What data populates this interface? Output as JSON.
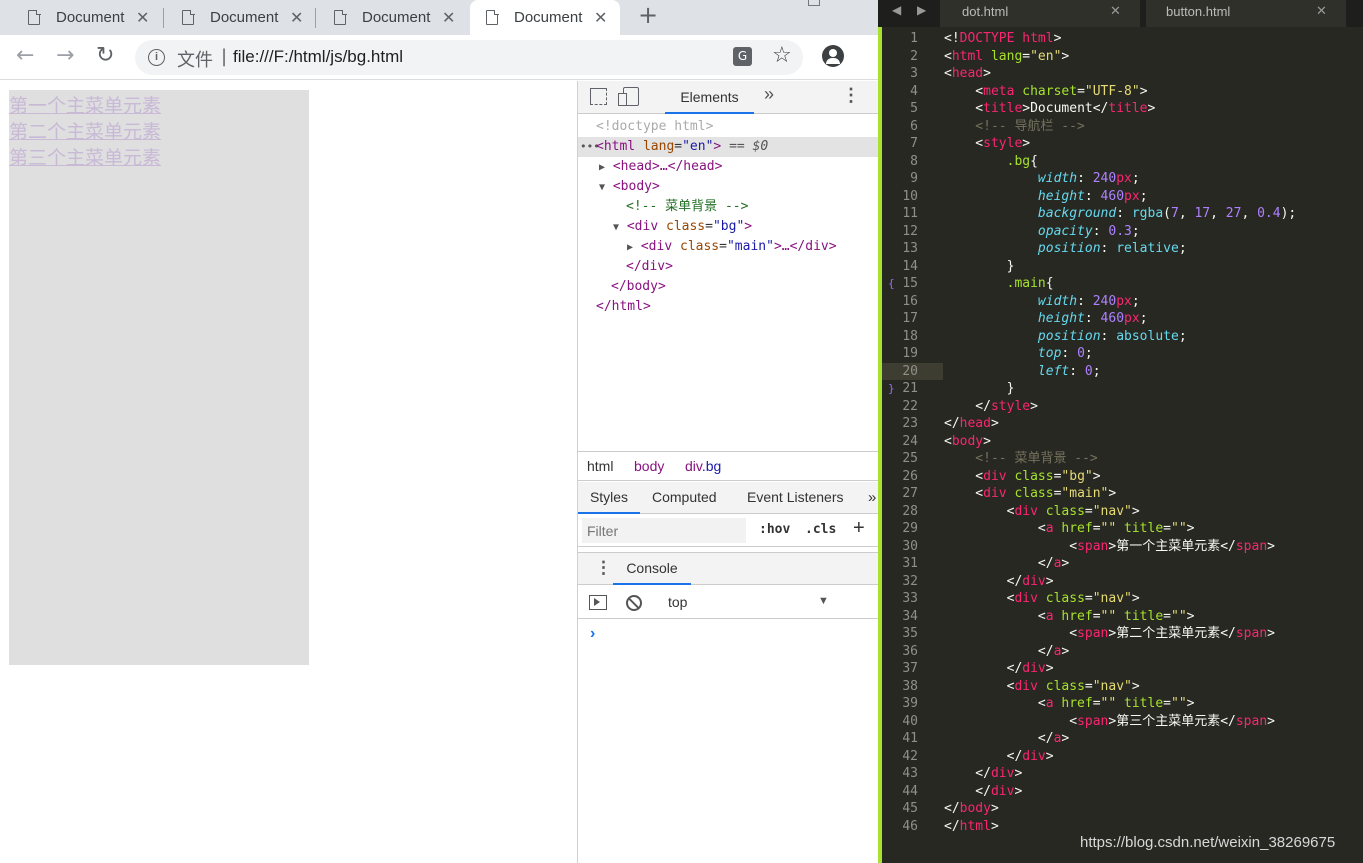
{
  "browser": {
    "tabs": [
      {
        "title": "Document",
        "close": "✕"
      },
      {
        "title": "Document",
        "close": "✕"
      },
      {
        "title": "Document",
        "close": "✕"
      },
      {
        "title": "Document",
        "close": "✕"
      }
    ],
    "new_tab": "+",
    "back": "←",
    "forward": "→",
    "reload": "↻",
    "url_prefix": "文件",
    "url_sep": "|",
    "url": "file:///F:/html/js/bg.html",
    "star": "☆",
    "menu": "⋮",
    "info_icon": "i",
    "translate_icon": "G"
  },
  "page": {
    "links": [
      "第一个主菜单元素",
      "第二个主菜单元素",
      "第三个主菜单元素"
    ]
  },
  "devtools": {
    "elements_tab": "Elements",
    "more_tabs": "»",
    "kebab": "⋮",
    "dom": {
      "doctype": "<!doctype html>",
      "dots": "•••",
      "html_open_tag": "<html",
      "lang_attr": "lang",
      "lang_val": "\"en\"",
      "html_close_angle": ">",
      "eq_sel": "== $0",
      "head_collapsed": "<head>…</head>",
      "body_open": "<body>",
      "comment": "<!-- 菜单背景 -->",
      "div_open": "<div",
      "class_attr": "class",
      "bg_val": "\"bg\"",
      "close_angle": ">",
      "main_val": "\"main\"",
      "main_rest": ">…</div>",
      "div_close": "</div>",
      "body_close": "</body>",
      "html_close": "</html>"
    },
    "breadcrumbs": {
      "html": "html",
      "body": "body",
      "div": "div",
      "div_class": ".bg"
    },
    "styles_tabs": {
      "styles": "Styles",
      "computed": "Computed",
      "events": "Event Listeners",
      "more": "»"
    },
    "filter_placeholder": "Filter",
    "hov": ":hov",
    "cls": ".cls",
    "plus": "+",
    "drawer_kebab": "⋮",
    "console_tab": "Console",
    "context": "top",
    "caret": "▼",
    "prompt": "›"
  },
  "editor": {
    "nav_arrows": "◀ ▶",
    "tabs": [
      {
        "name": "dot.html",
        "close": "✕"
      },
      {
        "name": "button.html",
        "close": "✕"
      }
    ],
    "line_numbers": [
      "1",
      "2",
      "3",
      "4",
      "5",
      "6",
      "7",
      "8",
      "9",
      "10",
      "11",
      "12",
      "13",
      "14",
      "15",
      "16",
      "17",
      "18",
      "19",
      "20",
      "21",
      "22",
      "23",
      "24",
      "25",
      "26",
      "27",
      "28",
      "29",
      "30",
      "31",
      "32",
      "33",
      "34",
      "35",
      "36",
      "37",
      "38",
      "39",
      "40",
      "41",
      "42",
      "43",
      "44",
      "45",
      "46"
    ],
    "current_line": 20,
    "fold_markers": {
      "15": "{",
      "21": "}"
    },
    "code": [
      [
        [
          "w",
          "<!"
        ],
        [
          "k",
          "DOCTYPE"
        ],
        [
          "w",
          " "
        ],
        [
          "k",
          "html"
        ],
        [
          "w",
          ">"
        ]
      ],
      [
        [
          "w",
          "<"
        ],
        [
          "k",
          "html"
        ],
        [
          "w",
          " "
        ],
        [
          "a",
          "lang"
        ],
        [
          "w",
          "="
        ],
        [
          "s",
          "\"en\""
        ],
        [
          "w",
          ">"
        ]
      ],
      [
        [
          "w",
          "<"
        ],
        [
          "k",
          "head"
        ],
        [
          "w",
          ">"
        ]
      ],
      [
        [
          "w",
          "    <"
        ],
        [
          "k",
          "meta"
        ],
        [
          "w",
          " "
        ],
        [
          "a",
          "charset"
        ],
        [
          "w",
          "="
        ],
        [
          "s",
          "\"UTF-8\""
        ],
        [
          "w",
          ">"
        ]
      ],
      [
        [
          "w",
          "    <"
        ],
        [
          "k",
          "title"
        ],
        [
          "w",
          ">Document</"
        ],
        [
          "k",
          "title"
        ],
        [
          "w",
          ">"
        ]
      ],
      [
        [
          "c",
          "    <!-- 导航栏 -->"
        ]
      ],
      [
        [
          "w",
          "    <"
        ],
        [
          "k",
          "style"
        ],
        [
          "w",
          ">"
        ]
      ],
      [
        [
          "w",
          "        "
        ],
        [
          "a",
          ".bg"
        ],
        [
          "w",
          "{"
        ]
      ],
      [
        [
          "w",
          "            "
        ],
        [
          "p",
          "width"
        ],
        [
          "w",
          ": "
        ],
        [
          "n",
          "240"
        ],
        [
          "k",
          "px"
        ],
        [
          "w",
          ";"
        ]
      ],
      [
        [
          "w",
          "            "
        ],
        [
          "p",
          "height"
        ],
        [
          "w",
          ": "
        ],
        [
          "n",
          "460"
        ],
        [
          "k",
          "px"
        ],
        [
          "w",
          ";"
        ]
      ],
      [
        [
          "w",
          "            "
        ],
        [
          "p",
          "background"
        ],
        [
          "w",
          ": "
        ],
        [
          "v",
          "rgba"
        ],
        [
          "w",
          "("
        ],
        [
          "n",
          "7"
        ],
        [
          "w",
          ", "
        ],
        [
          "n",
          "17"
        ],
        [
          "w",
          ", "
        ],
        [
          "n",
          "27"
        ],
        [
          "w",
          ", "
        ],
        [
          "n",
          "0.4"
        ],
        [
          "w",
          ");"
        ]
      ],
      [
        [
          "w",
          "            "
        ],
        [
          "p",
          "opacity"
        ],
        [
          "w",
          ": "
        ],
        [
          "n",
          "0.3"
        ],
        [
          "w",
          ";"
        ]
      ],
      [
        [
          "w",
          "            "
        ],
        [
          "p",
          "position"
        ],
        [
          "w",
          ": "
        ],
        [
          "v",
          "relative"
        ],
        [
          "w",
          ";"
        ]
      ],
      [
        [
          "w",
          "        }"
        ]
      ],
      [
        [
          "w",
          "        "
        ],
        [
          "a",
          ".main"
        ],
        [
          "w",
          "{"
        ]
      ],
      [
        [
          "w",
          "            "
        ],
        [
          "p",
          "width"
        ],
        [
          "w",
          ": "
        ],
        [
          "n",
          "240"
        ],
        [
          "k",
          "px"
        ],
        [
          "w",
          ";"
        ]
      ],
      [
        [
          "w",
          "            "
        ],
        [
          "p",
          "height"
        ],
        [
          "w",
          ": "
        ],
        [
          "n",
          "460"
        ],
        [
          "k",
          "px"
        ],
        [
          "w",
          ";"
        ]
      ],
      [
        [
          "w",
          "            "
        ],
        [
          "p",
          "position"
        ],
        [
          "w",
          ": "
        ],
        [
          "v",
          "absolute"
        ],
        [
          "w",
          ";"
        ]
      ],
      [
        [
          "w",
          "            "
        ],
        [
          "p",
          "top"
        ],
        [
          "w",
          ": "
        ],
        [
          "n",
          "0"
        ],
        [
          "w",
          ";"
        ]
      ],
      [
        [
          "w",
          "            "
        ],
        [
          "p",
          "left"
        ],
        [
          "w",
          ": "
        ],
        [
          "n",
          "0"
        ],
        [
          "w",
          ";"
        ]
      ],
      [
        [
          "w",
          "        }"
        ]
      ],
      [
        [
          "w",
          "    </"
        ],
        [
          "k",
          "style"
        ],
        [
          "w",
          ">"
        ]
      ],
      [
        [
          "w",
          "</"
        ],
        [
          "k",
          "head"
        ],
        [
          "w",
          ">"
        ]
      ],
      [
        [
          "w",
          "<"
        ],
        [
          "k",
          "body"
        ],
        [
          "w",
          ">"
        ]
      ],
      [
        [
          "c",
          "    <!-- 菜单背景 -->"
        ]
      ],
      [
        [
          "w",
          "    <"
        ],
        [
          "k",
          "div"
        ],
        [
          "w",
          " "
        ],
        [
          "a",
          "class"
        ],
        [
          "w",
          "="
        ],
        [
          "s",
          "\"bg\""
        ],
        [
          "w",
          ">"
        ]
      ],
      [
        [
          "w",
          "    <"
        ],
        [
          "k",
          "div"
        ],
        [
          "w",
          " "
        ],
        [
          "a",
          "class"
        ],
        [
          "w",
          "="
        ],
        [
          "s",
          "\"main\""
        ],
        [
          "w",
          ">"
        ]
      ],
      [
        [
          "w",
          "        <"
        ],
        [
          "k",
          "div"
        ],
        [
          "w",
          " "
        ],
        [
          "a",
          "class"
        ],
        [
          "w",
          "="
        ],
        [
          "s",
          "\"nav\""
        ],
        [
          "w",
          ">"
        ]
      ],
      [
        [
          "w",
          "            <"
        ],
        [
          "k",
          "a"
        ],
        [
          "w",
          " "
        ],
        [
          "a",
          "href"
        ],
        [
          "w",
          "="
        ],
        [
          "s",
          "\"\""
        ],
        [
          "w",
          " "
        ],
        [
          "a",
          "title"
        ],
        [
          "w",
          "="
        ],
        [
          "s",
          "\"\""
        ],
        [
          "w",
          ">"
        ]
      ],
      [
        [
          "w",
          "                <"
        ],
        [
          "k",
          "span"
        ],
        [
          "w",
          ">第一个主菜单元素</"
        ],
        [
          "k",
          "span"
        ],
        [
          "w",
          ">"
        ]
      ],
      [
        [
          "w",
          "            </"
        ],
        [
          "k",
          "a"
        ],
        [
          "w",
          ">"
        ]
      ],
      [
        [
          "w",
          "        </"
        ],
        [
          "k",
          "div"
        ],
        [
          "w",
          ">"
        ]
      ],
      [
        [
          "w",
          "        <"
        ],
        [
          "k",
          "div"
        ],
        [
          "w",
          " "
        ],
        [
          "a",
          "class"
        ],
        [
          "w",
          "="
        ],
        [
          "s",
          "\"nav\""
        ],
        [
          "w",
          ">"
        ]
      ],
      [
        [
          "w",
          "            <"
        ],
        [
          "k",
          "a"
        ],
        [
          "w",
          " "
        ],
        [
          "a",
          "href"
        ],
        [
          "w",
          "="
        ],
        [
          "s",
          "\"\""
        ],
        [
          "w",
          " "
        ],
        [
          "a",
          "title"
        ],
        [
          "w",
          "="
        ],
        [
          "s",
          "\"\""
        ],
        [
          "w",
          ">"
        ]
      ],
      [
        [
          "w",
          "                <"
        ],
        [
          "k",
          "span"
        ],
        [
          "w",
          ">第二个主菜单元素</"
        ],
        [
          "k",
          "span"
        ],
        [
          "w",
          ">"
        ]
      ],
      [
        [
          "w",
          "            </"
        ],
        [
          "k",
          "a"
        ],
        [
          "w",
          ">"
        ]
      ],
      [
        [
          "w",
          "        </"
        ],
        [
          "k",
          "div"
        ],
        [
          "w",
          ">"
        ]
      ],
      [
        [
          "w",
          "        <"
        ],
        [
          "k",
          "div"
        ],
        [
          "w",
          " "
        ],
        [
          "a",
          "class"
        ],
        [
          "w",
          "="
        ],
        [
          "s",
          "\"nav\""
        ],
        [
          "w",
          ">"
        ]
      ],
      [
        [
          "w",
          "            <"
        ],
        [
          "k",
          "a"
        ],
        [
          "w",
          " "
        ],
        [
          "a",
          "href"
        ],
        [
          "w",
          "="
        ],
        [
          "s",
          "\"\""
        ],
        [
          "w",
          " "
        ],
        [
          "a",
          "title"
        ],
        [
          "w",
          "="
        ],
        [
          "s",
          "\"\""
        ],
        [
          "w",
          ">"
        ]
      ],
      [
        [
          "w",
          "                <"
        ],
        [
          "k",
          "span"
        ],
        [
          "w",
          ">第三个主菜单元素</"
        ],
        [
          "k",
          "span"
        ],
        [
          "w",
          ">"
        ]
      ],
      [
        [
          "w",
          "            </"
        ],
        [
          "k",
          "a"
        ],
        [
          "w",
          ">"
        ]
      ],
      [
        [
          "w",
          "        </"
        ],
        [
          "k",
          "div"
        ],
        [
          "w",
          ">"
        ]
      ],
      [
        [
          "w",
          "    </"
        ],
        [
          "k",
          "div"
        ],
        [
          "w",
          ">"
        ]
      ],
      [
        [
          "w",
          "    </"
        ],
        [
          "k",
          "div"
        ],
        [
          "w",
          ">"
        ]
      ],
      [
        [
          "w",
          "</"
        ],
        [
          "k",
          "body"
        ],
        [
          "w",
          ">"
        ]
      ],
      [
        [
          "w",
          "</"
        ],
        [
          "k",
          "html"
        ],
        [
          "w",
          ">"
        ]
      ]
    ],
    "watermark": "https://blog.csdn.net/weixin_38269675"
  }
}
